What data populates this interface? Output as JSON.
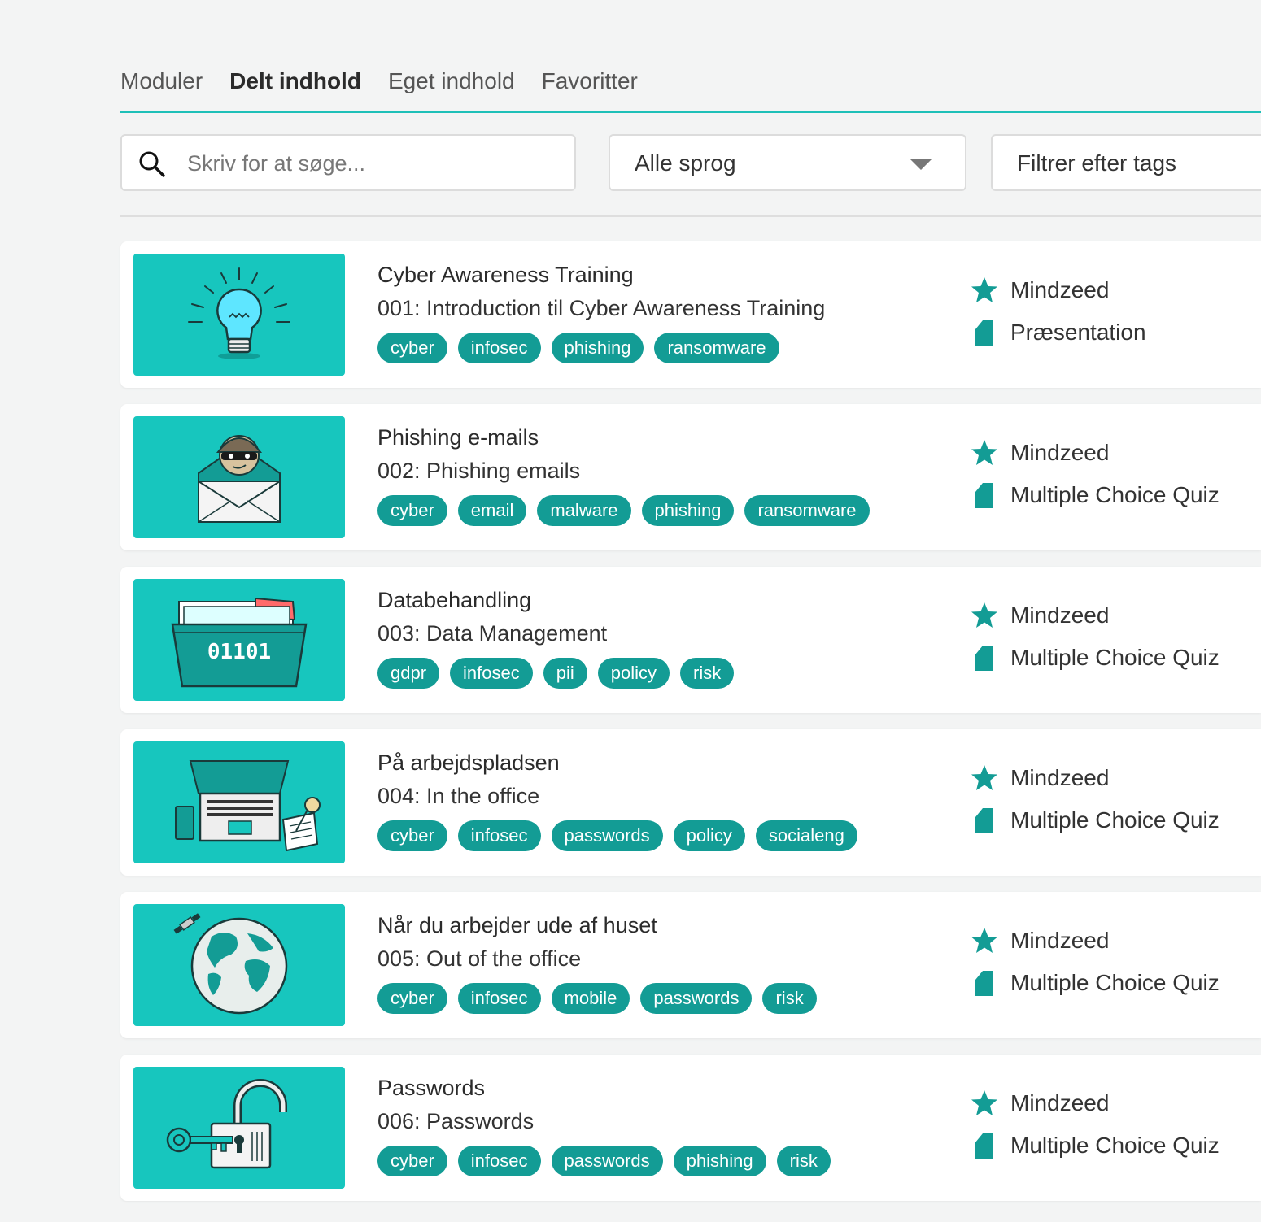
{
  "tabs": [
    {
      "label": "Moduler"
    },
    {
      "label": "Delt indhold"
    },
    {
      "label": "Eget indhold"
    },
    {
      "label": "Favoritter"
    }
  ],
  "search": {
    "placeholder": "Skriv for at søge..."
  },
  "language_filter": {
    "selected": "Alle sprog"
  },
  "tag_filter": {
    "label": "Filtrer efter tags"
  },
  "colors": {
    "accent": "#1ec0b8",
    "tag_bg": "#139c95",
    "thumb_bg": "#17c6be"
  },
  "modules": [
    {
      "title": "Cyber Awareness Training",
      "subtitle": "001: Introduction til Cyber Awareness Training",
      "tags": [
        "cyber",
        "infosec",
        "phishing",
        "ransomware"
      ],
      "author": "Mindzeed",
      "type": "Præsentation",
      "illustration": "lightbulb-icon"
    },
    {
      "title": "Phishing e-mails",
      "subtitle": "002: Phishing emails",
      "tags": [
        "cyber",
        "email",
        "malware",
        "phishing",
        "ransomware"
      ],
      "author": "Mindzeed",
      "type": "Multiple Choice Quiz",
      "illustration": "hacker-envelope-icon"
    },
    {
      "title": "Databehandling",
      "subtitle": "003: Data Management",
      "tags": [
        "gdpr",
        "infosec",
        "pii",
        "policy",
        "risk"
      ],
      "author": "Mindzeed",
      "type": "Multiple Choice Quiz",
      "illustration": "data-folder-icon",
      "folder_text": "01101"
    },
    {
      "title": "På arbejdspladsen",
      "subtitle": "004: In the office",
      "tags": [
        "cyber",
        "infosec",
        "passwords",
        "policy",
        "socialeng"
      ],
      "author": "Mindzeed",
      "type": "Multiple Choice Quiz",
      "illustration": "laptop-desk-icon"
    },
    {
      "title": "Når du arbejder ude af huset",
      "subtitle": "005: Out of the office",
      "tags": [
        "cyber",
        "infosec",
        "mobile",
        "passwords",
        "risk"
      ],
      "author": "Mindzeed",
      "type": "Multiple Choice Quiz",
      "illustration": "globe-satellite-icon"
    },
    {
      "title": "Passwords",
      "subtitle": "006: Passwords",
      "tags": [
        "cyber",
        "infosec",
        "passwords",
        "phishing",
        "risk"
      ],
      "author": "Mindzeed",
      "type": "Multiple Choice Quiz",
      "illustration": "padlock-key-icon"
    }
  ]
}
